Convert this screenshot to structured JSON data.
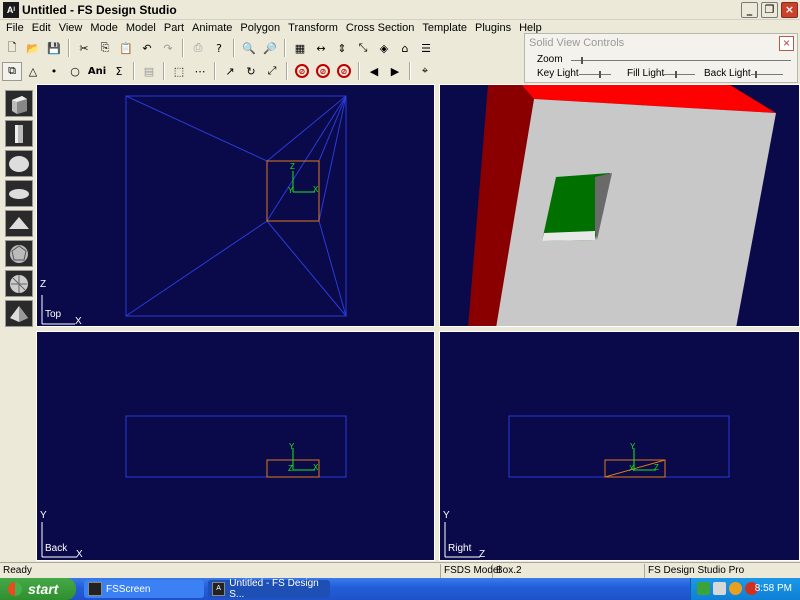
{
  "window": {
    "app_icon": "Aᴵ",
    "title": "Untitled - FS Design Studio",
    "min_icon": "minimize-icon",
    "max_icon": "maximize-icon",
    "close_icon": "close-icon"
  },
  "menu": [
    "File",
    "Edit",
    "View",
    "Mode",
    "Model",
    "Part",
    "Animate",
    "Polygon",
    "Transform",
    "Cross Section",
    "Template",
    "Plugins",
    "Help"
  ],
  "toolbar1": {
    "icons": [
      "new-file-icon",
      "open-folder-icon",
      "save-icon",
      "cut-icon",
      "copy-icon",
      "paste-icon",
      "undo-icon",
      "redo-icon",
      "print-icon",
      "help-icon",
      "zoom-in-icon",
      "zoom-out-icon",
      "grid-icon",
      "scale-x-icon",
      "scale-y-icon",
      "scale-z-icon",
      "view-icon",
      "home-icon",
      "align-icon"
    ]
  },
  "toolbar2": {
    "ani_label": "Ani",
    "sigma_label": "Σ",
    "icons": [
      "select-icon",
      "triangle-icon",
      "dot-icon",
      "circle-icon",
      "ani-icon",
      "sigma-icon",
      "texture-icon",
      "select-box-icon",
      "line-select-icon",
      "arrow-curve-icon",
      "rotate-icon",
      "fit-icon",
      "no-entry-icon-1",
      "no-entry-icon-2",
      "no-entry-icon-3",
      "play-back-icon",
      "play-forward-icon",
      "binoculars-icon"
    ]
  },
  "solid_view_controls": {
    "title": "Solid View Controls",
    "close": "×",
    "zoom_label": "Zoom",
    "key_light_label": "Key Light",
    "fill_light_label": "Fill Light",
    "back_light_label": "Back Light"
  },
  "palette": [
    "cube-icon",
    "cylinder-icon",
    "sphere-icon",
    "disc-icon",
    "cone-icon",
    "geosphere-icon",
    "globe-icon",
    "pyramid-icon"
  ],
  "viewports": {
    "top": {
      "label": "Top",
      "axis_h": "X",
      "axis_v": "Z"
    },
    "back": {
      "label": "Back",
      "axis_h": "X",
      "axis_v": "Y"
    },
    "right": {
      "label": "Right",
      "axis_h": "Z",
      "axis_v": "Y"
    },
    "gizmo": {
      "y": "Y",
      "x": "X",
      "z": "Z"
    }
  },
  "colors": {
    "viewport_bg": "#0a0a4a",
    "wire_blue": "#2a3ad8",
    "selection_orange": "#e0781c",
    "gizmo_green": "#18e818",
    "solid_red": "#ff0000",
    "solid_grey": "#c8c8c8",
    "solid_green": "#007000"
  },
  "status": {
    "ready": "Ready",
    "model": "FSDS Model",
    "part": "Box.2",
    "product": "FS Design Studio Pro"
  },
  "taskbar": {
    "start": "start",
    "tasks": [
      "FSScreen",
      "Untitled - FS Design S..."
    ],
    "clock": "8:58 PM"
  }
}
